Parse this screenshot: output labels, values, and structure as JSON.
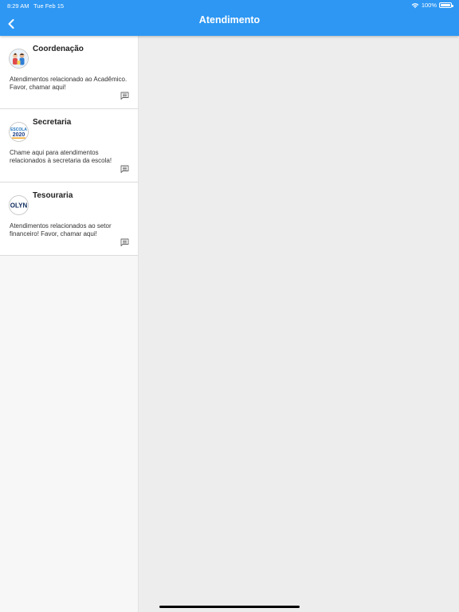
{
  "status_bar": {
    "time": "8:29 AM",
    "date": "Tue Feb 15",
    "battery": "100%"
  },
  "header": {
    "title": "Atendimento"
  },
  "icons": {
    "back": "chevron-left-icon",
    "chat": "chat-icon",
    "wifi": "wifi-icon",
    "battery": "battery-icon"
  },
  "colors": {
    "header_bg": "#2d97f3",
    "sidebar_bg": "#f7f7f7",
    "content_bg": "#ededed"
  },
  "channels": [
    {
      "title": "Coordenação",
      "description": "Atendimentos relacionado ao Acadêmico. Favor, chamar aqui!",
      "avatar": "people-illustration"
    },
    {
      "title": "Secretaria",
      "description": "Chame aqui para atendimentos relacionados à secretaria da escola!",
      "avatar": "escola-2020-logo",
      "avatar_text_top": "ESCOLA",
      "avatar_text_bottom": "2020"
    },
    {
      "title": "Tesouraria",
      "description": "Atendimentos relacionados ao setor financeiro! Favor, chamar aqui!",
      "avatar": "olyn-logo",
      "avatar_text": "OLYN"
    }
  ]
}
